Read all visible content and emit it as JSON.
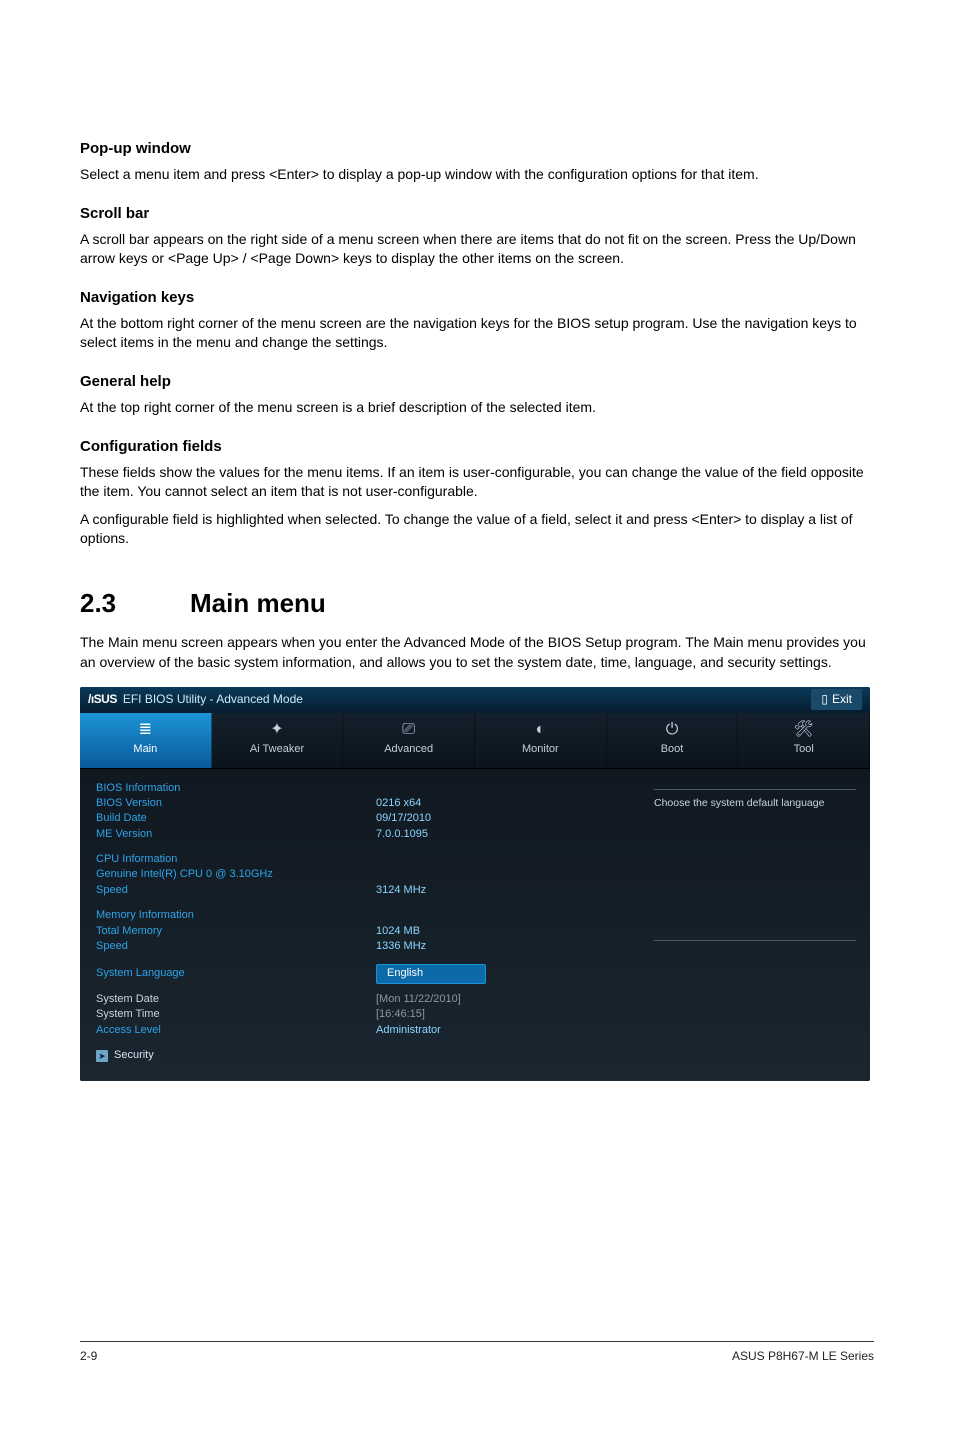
{
  "sections": {
    "popup": {
      "heading": "Pop-up window",
      "text": "Select a menu item and press <Enter> to display a pop-up window with the configuration options for that item."
    },
    "scrollbar": {
      "heading": "Scroll bar",
      "text": "A scroll bar appears on the right side of a menu screen when there are items that do not fit on the screen. Press the Up/Down arrow keys or <Page Up> / <Page Down> keys to display the other items on the screen."
    },
    "navkeys": {
      "heading": "Navigation keys",
      "text": "At the bottom right corner of the menu screen are the navigation keys for the BIOS setup program. Use the navigation keys to select items in the menu and change the settings."
    },
    "genhelp": {
      "heading": "General help",
      "text": "At the top right corner of the menu screen is a brief description of the selected item."
    },
    "config": {
      "heading": "Configuration fields",
      "text1": "These fields show the values for the menu items. If an item is user-configurable, you can change the value of the field opposite the item. You cannot select an item that is not user-configurable.",
      "text2": "A configurable field is highlighted when selected. To change the value of a field, select it and press <Enter> to display a list of options."
    },
    "mainmenu": {
      "num": "2.3",
      "title": "Main menu",
      "text": "The Main menu screen appears when you enter the Advanced Mode of the BIOS Setup program. The Main menu provides you an overview of the basic system information, and allows you to set the system date, time, language, and security settings."
    }
  },
  "bios": {
    "brand": "/ıSUS",
    "title": "EFI BIOS Utility - Advanced Mode",
    "exit": "Exit",
    "tabs": {
      "main": "Main",
      "tweaker": "Ai  Tweaker",
      "advanced": "Advanced",
      "monitor": "Monitor",
      "boot": "Boot",
      "tool": "Tool"
    },
    "help": "Choose the system default language",
    "biosinfo": {
      "heading": "BIOS Information",
      "version_l": "BIOS Version",
      "version_v": "0216 x64",
      "build_l": "Build Date",
      "build_v": "09/17/2010",
      "me_l": "ME Version",
      "me_v": "7.0.0.1095"
    },
    "cpuinfo": {
      "heading": "CPU Information",
      "name": "Genuine Intel(R) CPU 0 @ 3.10GHz",
      "speed_l": "Speed",
      "speed_v": "3124 MHz"
    },
    "meminfo": {
      "heading": "Memory Information",
      "total_l": "Total Memory",
      "total_v": "1024 MB",
      "speed_l": "Speed",
      "speed_v": "1336 MHz"
    },
    "lang_l": "System Language",
    "lang_v": "English",
    "date_l": "System Date",
    "date_v": "[Mon 11/22/2010]",
    "time_l": "System Time",
    "time_v": "[16:46:15]",
    "access_l": "Access Level",
    "access_v": "Administrator",
    "security": "Security"
  },
  "footer": {
    "page": "2-9",
    "product": "ASUS P8H67-M LE Series"
  }
}
